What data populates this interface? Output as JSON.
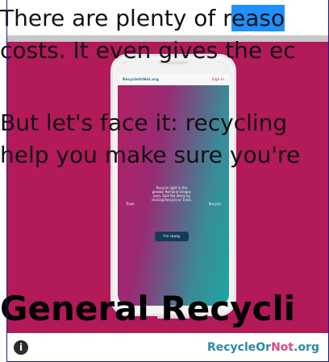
{
  "article": {
    "para1_line1_pre": "There are plenty of r",
    "para1_line1_highlight": "easo",
    "para1_line2": "costs. It even gives the ec",
    "para2_line1": "But let's face it: recycling",
    "para2_line2": "help you make sure you're",
    "heading": "General Recycli"
  },
  "phone": {
    "brand": "RecycleOrNot.org",
    "signin": "Sign in",
    "card_text": "Recycle right in the greater Portland Oregon area. Sort the items by clicking Recycle or Trash.",
    "left_label": "Trash",
    "right_label": "Recycle",
    "button_label": "I'm ready"
  },
  "caption": {
    "info_icon": "i",
    "brand_part1": "RecycleOr",
    "brand_part2": "Not",
    "brand_part3": ".org"
  },
  "colors": {
    "hero_bg": "#b21a5a",
    "highlight": "#1e90ff",
    "brand_teal": "#2b8aa6",
    "brand_pink": "#e0487f"
  }
}
